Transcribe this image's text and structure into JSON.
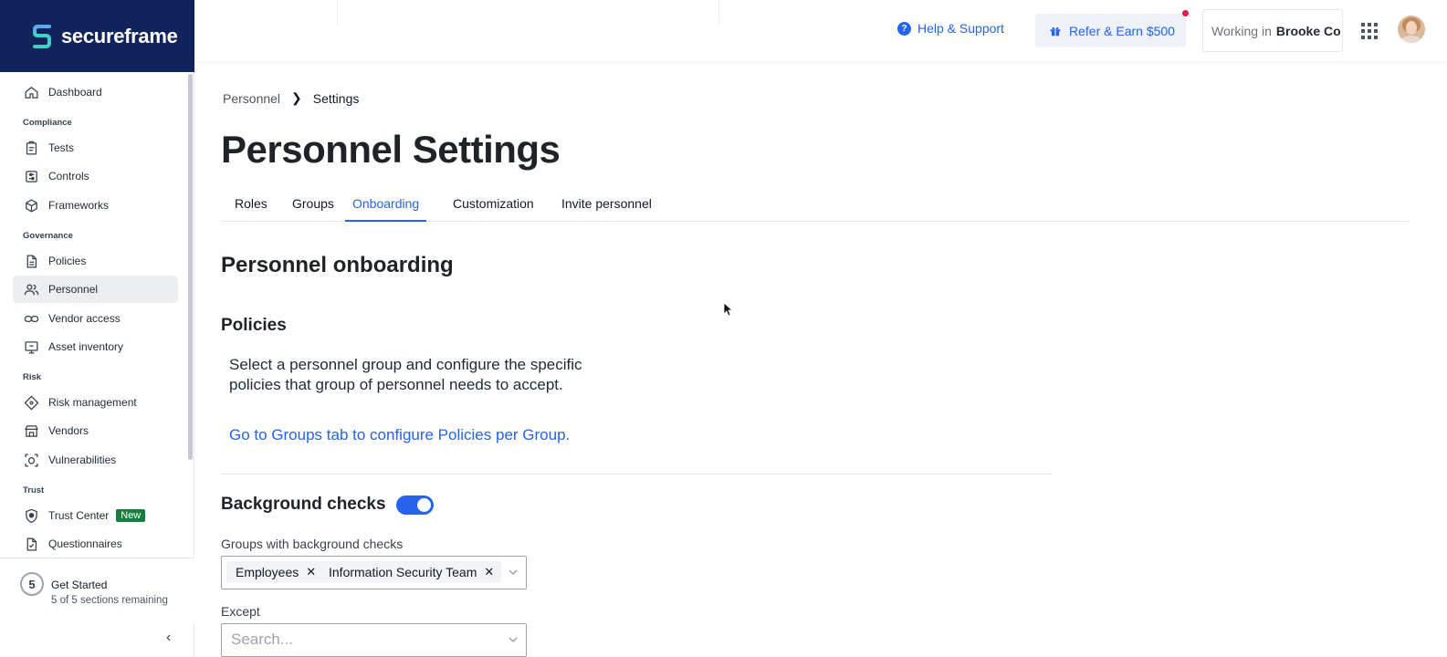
{
  "brand": {
    "name": "secureframe"
  },
  "sidebar": {
    "items": [
      {
        "label": "Dashboard",
        "icon": "home-icon"
      },
      {
        "label": "Tests",
        "icon": "clipboard-icon"
      },
      {
        "label": "Controls",
        "icon": "sliders-icon"
      },
      {
        "label": "Frameworks",
        "icon": "cube-icon"
      },
      {
        "label": "Policies",
        "icon": "document-icon"
      },
      {
        "label": "Personnel",
        "icon": "users-icon"
      },
      {
        "label": "Vendor access",
        "icon": "link-icon"
      },
      {
        "label": "Asset inventory",
        "icon": "monitor-icon"
      },
      {
        "label": "Risk management",
        "icon": "diamond-icon"
      },
      {
        "label": "Vendors",
        "icon": "store-icon"
      },
      {
        "label": "Vulnerabilities",
        "icon": "bug-icon"
      },
      {
        "label": "Trust Center",
        "icon": "shield-icon",
        "badge": "New"
      },
      {
        "label": "Questionnaires",
        "icon": "questionnaire-icon"
      }
    ],
    "sections": [
      "Compliance",
      "Governance",
      "Risk",
      "Trust"
    ],
    "active": "Personnel",
    "get_started": {
      "count": "5",
      "title": "Get Started",
      "subtitle": "5 of 5 sections remaining"
    }
  },
  "topbar": {
    "help_label": "Help & Support",
    "refer_label": "Refer & Earn $500",
    "working_prefix": "Working in",
    "working_company": "Brooke Co"
  },
  "breadcrumb": {
    "parent": "Personnel",
    "current": "Settings"
  },
  "page": {
    "title": "Personnel Settings",
    "tabs": [
      "Roles",
      "Groups",
      "Onboarding",
      "Customization",
      "Invite personnel"
    ],
    "active_tab": "Onboarding",
    "section_title": "Personnel onboarding",
    "policies": {
      "title": "Policies",
      "description": "Select a personnel group and configure the specific policies that group of personnel needs to accept.",
      "link": "Go to Groups tab to configure Policies per Group."
    },
    "background_checks": {
      "title": "Background checks",
      "enabled": true,
      "groups_label": "Groups with background checks",
      "groups": [
        "Employees",
        "Information Security Team"
      ],
      "except_label": "Except",
      "except_placeholder": "Search..."
    }
  },
  "colors": {
    "brand_navy": "#10245b",
    "accent": "#2563eb",
    "badge_green": "#15803d",
    "dot_red": "#e11d48"
  }
}
